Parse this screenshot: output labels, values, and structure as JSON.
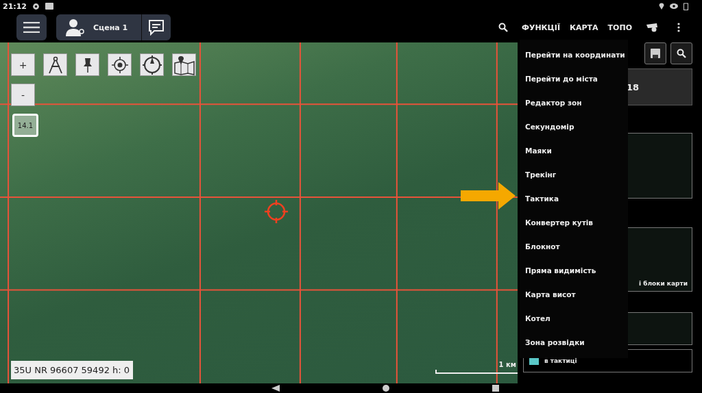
{
  "status_bar": {
    "time": "21:12"
  },
  "top_bar": {
    "scene": "Сцена 1",
    "menu_tabs": [
      "ФУНКЦІЇ",
      "КАРТА",
      "ТОПО"
    ]
  },
  "map": {
    "zoom_in": "+",
    "zoom_out": "-",
    "zoom": "14.1",
    "coordinates": "35U NR 96607 59492 h: 0",
    "scale": "1 км"
  },
  "functions_menu": {
    "items": [
      "Перейти на координати",
      "Перейти до міста",
      "Редактор зон",
      "Секундомір",
      "Маяки",
      "Трекінг",
      "Тактика",
      "Конвертер кутів",
      "Блокнот",
      "Пряма видимість",
      "Карта висот",
      "Котел",
      "Зона розвідки"
    ]
  },
  "side_panel": {
    "value": "18",
    "layers_label": "і блоки карти",
    "tactics_label": "в тактиці",
    "tactics_checked": true
  }
}
